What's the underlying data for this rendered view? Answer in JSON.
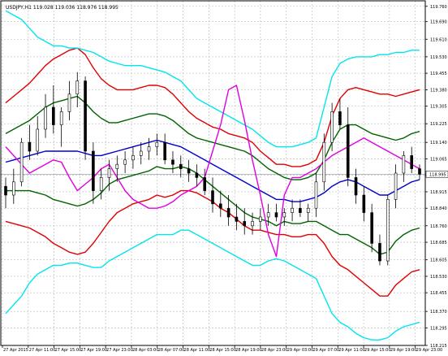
{
  "window": {
    "symbol_header": "USDJPY,H1  119.028 119.036 118.976 118.995"
  },
  "price_label": "118.995",
  "colors": {
    "background": "#ffffff",
    "grid": "#b8b8b8",
    "frame": "#000000",
    "price_line": "#9aa8b8",
    "bb_outer": "#00e5ee",
    "bb_mid": "#e00000",
    "bb_inner": "#006400",
    "ma": "#0000d0",
    "oscillator": "#e000e0",
    "candle_up": "#ffffff",
    "candle_down": "#000000"
  },
  "chart_data": {
    "type": "candlestick",
    "title": "USDJPY,H1",
    "ohlc_header": {
      "open": 119.028,
      "high": 119.036,
      "low": 118.976,
      "close": 118.995
    },
    "ylim": [
      118.215,
      119.785
    ],
    "y_ticks": [
      "119.760",
      "119.690",
      "119.610",
      "119.530",
      "119.455",
      "119.380",
      "119.305",
      "119.225",
      "119.140",
      "119.065",
      "118.990",
      "118.915",
      "118.840",
      "118.760",
      "118.685",
      "118.605",
      "118.530",
      "118.455",
      "118.370",
      "118.295",
      "118.215"
    ],
    "x_tick_labels": [
      "27 Apr 2015",
      "27 Apr 11:00",
      "27 Apr 15:00",
      "27 Apr 19:00",
      "27 Apr 23:00",
      "28 Apr 03:00",
      "28 Apr 07:00",
      "28 Apr 11:00",
      "28 Apr 15:00",
      "28 Apr 19:00",
      "28 Apr 23:00",
      "29 Apr 03:00",
      "29 Apr 07:00",
      "29 Apr 11:00",
      "29 Apr 15:00",
      "29 Apr 19:00",
      "29 Apr 23:00"
    ],
    "candles": [
      [
        118.94,
        118.98,
        118.84,
        118.9
      ],
      [
        118.9,
        119.02,
        118.86,
        118.96
      ],
      [
        118.96,
        119.16,
        118.94,
        119.14
      ],
      [
        119.14,
        119.22,
        119.06,
        119.1
      ],
      [
        119.1,
        119.26,
        119.08,
        119.2
      ],
      [
        119.2,
        119.36,
        119.16,
        119.3
      ],
      [
        119.3,
        119.4,
        119.18,
        119.22
      ],
      [
        119.22,
        119.3,
        119.12,
        119.28
      ],
      [
        119.28,
        119.42,
        119.24,
        119.36
      ],
      [
        119.36,
        119.46,
        119.3,
        119.42
      ],
      [
        119.42,
        119.44,
        119.06,
        119.1
      ],
      [
        119.1,
        119.14,
        118.86,
        118.92
      ],
      [
        118.92,
        119.02,
        118.88,
        118.98
      ],
      [
        118.98,
        119.06,
        118.92,
        119.02
      ],
      [
        119.02,
        119.08,
        118.96,
        119.04
      ],
      [
        119.04,
        119.1,
        119.0,
        119.06
      ],
      [
        119.06,
        119.12,
        119.02,
        119.08
      ],
      [
        119.08,
        119.14,
        119.04,
        119.1
      ],
      [
        119.1,
        119.16,
        119.06,
        119.12
      ],
      [
        119.12,
        119.18,
        119.08,
        119.14
      ],
      [
        119.14,
        119.18,
        119.04,
        119.06
      ],
      [
        119.06,
        119.1,
        119.0,
        119.04
      ],
      [
        119.04,
        119.08,
        118.98,
        119.02
      ],
      [
        119.02,
        119.06,
        118.96,
        119.0
      ],
      [
        119.0,
        119.04,
        118.94,
        118.98
      ],
      [
        118.98,
        119.02,
        118.9,
        118.92
      ],
      [
        118.92,
        118.98,
        118.82,
        118.86
      ],
      [
        118.86,
        118.92,
        118.8,
        118.84
      ],
      [
        118.84,
        118.9,
        118.76,
        118.8
      ],
      [
        118.8,
        118.86,
        118.74,
        118.78
      ],
      [
        118.78,
        118.84,
        118.72,
        118.76
      ],
      [
        118.76,
        118.82,
        118.72,
        118.78
      ],
      [
        118.78,
        118.84,
        118.74,
        118.8
      ],
      [
        118.8,
        118.86,
        118.76,
        118.82
      ],
      [
        118.82,
        118.86,
        118.78,
        118.8
      ],
      [
        118.8,
        118.84,
        118.76,
        118.82
      ],
      [
        118.82,
        118.88,
        118.78,
        118.84
      ],
      [
        118.84,
        118.88,
        118.8,
        118.82
      ],
      [
        118.82,
        118.86,
        118.78,
        118.84
      ],
      [
        118.84,
        119.0,
        118.8,
        118.96
      ],
      [
        118.96,
        119.18,
        118.92,
        119.14
      ],
      [
        119.14,
        119.32,
        119.1,
        119.28
      ],
      [
        119.28,
        119.34,
        119.2,
        119.22
      ],
      [
        119.22,
        119.3,
        118.94,
        118.98
      ],
      [
        118.98,
        119.02,
        118.86,
        118.9
      ],
      [
        118.9,
        118.94,
        118.78,
        118.82
      ],
      [
        118.82,
        118.86,
        118.64,
        118.68
      ],
      [
        118.68,
        118.72,
        118.58,
        118.6
      ],
      [
        118.6,
        118.9,
        118.58,
        118.88
      ],
      [
        118.88,
        119.04,
        118.84,
        119.0
      ],
      [
        119.0,
        119.1,
        118.96,
        119.08
      ],
      [
        119.08,
        119.12,
        119.0,
        119.02
      ],
      [
        119.02,
        119.04,
        118.97,
        118.995
      ]
    ],
    "series": [
      {
        "name": "ma",
        "values": [
          119.05,
          119.06,
          119.07,
          119.08,
          119.09,
          119.1,
          119.1,
          119.1,
          119.1,
          119.1,
          119.09,
          119.08,
          119.08,
          119.09,
          119.1,
          119.11,
          119.12,
          119.13,
          119.14,
          119.15,
          119.14,
          119.13,
          119.12,
          119.1,
          119.08,
          119.06,
          119.04,
          119.02,
          119.0,
          118.98,
          118.96,
          118.94,
          118.92,
          118.9,
          118.88,
          118.88,
          118.87,
          118.87,
          118.88,
          118.89,
          118.91,
          118.94,
          118.96,
          118.97,
          118.96,
          118.94,
          118.92,
          118.9,
          118.9,
          118.92,
          118.94,
          118.96,
          118.97
        ]
      },
      {
        "name": "bb_inner_upper",
        "values": [
          119.18,
          119.2,
          119.22,
          119.24,
          119.27,
          119.3,
          119.32,
          119.33,
          119.34,
          119.35,
          119.32,
          119.28,
          119.25,
          119.23,
          119.23,
          119.24,
          119.25,
          119.26,
          119.27,
          119.27,
          119.26,
          119.24,
          119.21,
          119.18,
          119.16,
          119.15,
          119.14,
          119.13,
          119.12,
          119.11,
          119.1,
          119.08,
          119.05,
          119.02,
          119.0,
          118.98,
          118.97,
          118.97,
          118.98,
          119.0,
          119.06,
          119.14,
          119.2,
          119.22,
          119.22,
          119.2,
          119.18,
          119.17,
          119.16,
          119.15,
          119.16,
          119.18,
          119.19
        ]
      },
      {
        "name": "bb_inner_lower",
        "values": [
          118.92,
          118.92,
          118.92,
          118.92,
          118.91,
          118.9,
          118.88,
          118.87,
          118.86,
          118.85,
          118.86,
          118.88,
          118.91,
          118.95,
          118.97,
          118.98,
          118.99,
          119.0,
          119.01,
          119.03,
          119.02,
          119.02,
          119.03,
          119.02,
          119.0,
          118.97,
          118.94,
          118.91,
          118.88,
          118.85,
          118.82,
          118.8,
          118.79,
          118.78,
          118.76,
          118.78,
          118.77,
          118.77,
          118.78,
          118.78,
          118.76,
          118.74,
          118.72,
          118.72,
          118.7,
          118.68,
          118.66,
          118.63,
          118.64,
          118.69,
          118.72,
          118.74,
          118.75
        ]
      },
      {
        "name": "bb_mid_upper",
        "values": [
          119.32,
          119.35,
          119.38,
          119.41,
          119.45,
          119.49,
          119.52,
          119.54,
          119.56,
          119.57,
          119.54,
          119.48,
          119.43,
          119.4,
          119.38,
          119.38,
          119.38,
          119.39,
          119.4,
          119.4,
          119.39,
          119.36,
          119.32,
          119.28,
          119.25,
          119.23,
          119.21,
          119.2,
          119.18,
          119.17,
          119.16,
          119.14,
          119.1,
          119.07,
          119.04,
          119.04,
          119.03,
          119.03,
          119.04,
          119.06,
          119.14,
          119.26,
          119.34,
          119.38,
          119.39,
          119.38,
          119.37,
          119.36,
          119.36,
          119.35,
          119.36,
          119.37,
          119.38
        ]
      },
      {
        "name": "bb_mid_lower",
        "values": [
          118.78,
          118.77,
          118.76,
          118.75,
          118.73,
          118.71,
          118.68,
          118.66,
          118.64,
          118.63,
          118.64,
          118.68,
          118.73,
          118.78,
          118.82,
          118.84,
          118.86,
          118.87,
          118.88,
          118.9,
          118.89,
          118.9,
          118.92,
          118.92,
          118.91,
          118.89,
          118.87,
          118.84,
          118.82,
          118.79,
          118.76,
          118.74,
          118.74,
          118.73,
          118.72,
          118.72,
          118.71,
          118.71,
          118.72,
          118.72,
          118.68,
          118.62,
          118.58,
          118.56,
          118.53,
          118.5,
          118.47,
          118.44,
          118.44,
          118.49,
          118.52,
          118.55,
          118.56
        ]
      },
      {
        "name": "bb_outer_upper",
        "values": [
          119.74,
          119.72,
          119.7,
          119.66,
          119.62,
          119.6,
          119.58,
          119.58,
          119.57,
          119.57,
          119.56,
          119.55,
          119.53,
          119.51,
          119.5,
          119.49,
          119.49,
          119.49,
          119.48,
          119.47,
          119.46,
          119.44,
          119.42,
          119.38,
          119.34,
          119.32,
          119.3,
          119.28,
          119.26,
          119.24,
          119.22,
          119.2,
          119.17,
          119.14,
          119.12,
          119.12,
          119.12,
          119.13,
          119.14,
          119.16,
          119.3,
          119.44,
          119.5,
          119.52,
          119.53,
          119.53,
          119.53,
          119.54,
          119.54,
          119.55,
          119.55,
          119.56,
          119.56
        ]
      },
      {
        "name": "bb_outer_lower",
        "values": [
          118.36,
          118.4,
          118.44,
          118.5,
          118.54,
          118.56,
          118.58,
          118.58,
          118.59,
          118.59,
          118.58,
          118.57,
          118.57,
          118.6,
          118.62,
          118.64,
          118.66,
          118.68,
          118.7,
          118.72,
          118.72,
          118.72,
          118.74,
          118.74,
          118.72,
          118.7,
          118.68,
          118.66,
          118.64,
          118.62,
          118.6,
          118.58,
          118.58,
          118.6,
          118.61,
          118.6,
          118.58,
          118.56,
          118.54,
          118.52,
          118.44,
          118.36,
          118.32,
          118.3,
          118.27,
          118.25,
          118.24,
          118.24,
          118.25,
          118.28,
          118.3,
          118.31,
          118.32
        ]
      },
      {
        "name": "oscillator",
        "values": [
          119.12,
          119.08,
          119.04,
          119.0,
          119.02,
          119.04,
          119.06,
          119.05,
          118.98,
          118.92,
          118.95,
          118.98,
          119.02,
          119.04,
          118.98,
          118.92,
          118.88,
          118.86,
          118.84,
          118.84,
          118.85,
          118.87,
          118.9,
          118.92,
          118.94,
          118.98,
          119.1,
          119.22,
          119.38,
          119.4,
          119.24,
          119.06,
          118.9,
          118.72,
          118.62,
          118.9,
          118.98,
          118.98,
          119.0,
          119.02,
          119.05,
          119.08,
          119.1,
          119.12,
          119.14,
          119.16,
          119.14,
          119.12,
          119.1,
          119.08,
          119.06,
          119.04,
          119.02
        ]
      }
    ]
  }
}
